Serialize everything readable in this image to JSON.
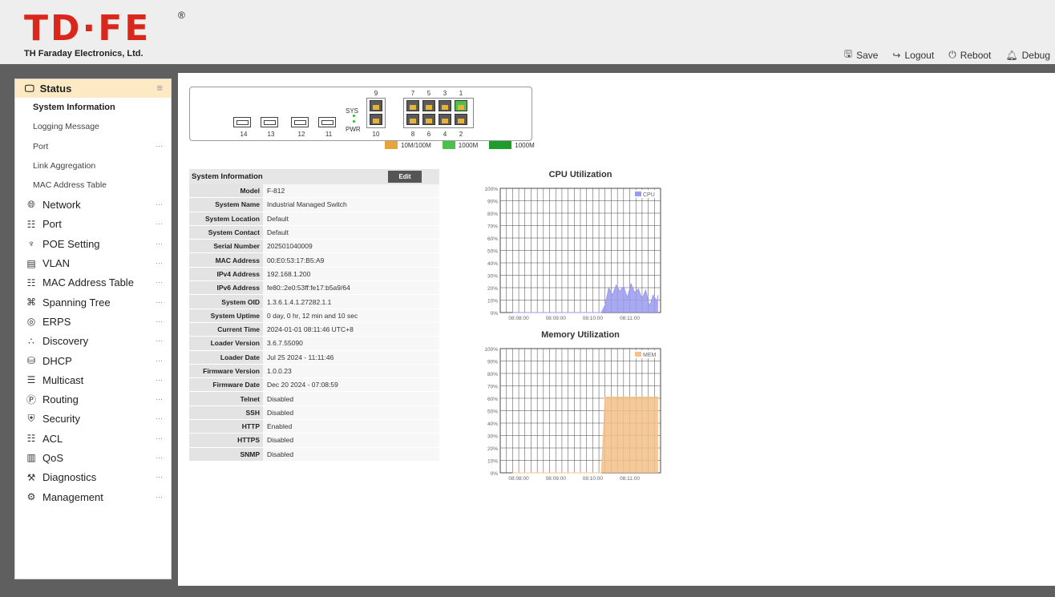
{
  "header": {
    "logo_text": "TD·FE",
    "logo_reg": "®",
    "company": "TH Faraday Electronics, Ltd.",
    "actions": [
      {
        "label": "Save",
        "icon": "save-icon"
      },
      {
        "label": "Logout",
        "icon": "logout-icon"
      },
      {
        "label": "Reboot",
        "icon": "power-icon"
      },
      {
        "label": "Debug",
        "icon": "bell-icon"
      }
    ]
  },
  "sidebar": {
    "status": {
      "label": "Status",
      "items": [
        "System Information",
        "Logging Message",
        "Port",
        "Link Aggregation",
        "MAC Address Table"
      ]
    },
    "menu": [
      {
        "label": "Network",
        "icon": "globe-icon"
      },
      {
        "label": "Port",
        "icon": "port-icon"
      },
      {
        "label": "POE Setting",
        "icon": "plug-icon"
      },
      {
        "label": "VLAN",
        "icon": "vlan-icon"
      },
      {
        "label": "MAC Address Table",
        "icon": "table-icon"
      },
      {
        "label": "Spanning Tree",
        "icon": "tree-icon"
      },
      {
        "label": "ERPS",
        "icon": "ring-icon"
      },
      {
        "label": "Discovery",
        "icon": "discovery-icon"
      },
      {
        "label": "DHCP",
        "icon": "database-icon"
      },
      {
        "label": "Multicast",
        "icon": "multicast-icon"
      },
      {
        "label": "Routing",
        "icon": "routing-icon"
      },
      {
        "label": "Security",
        "icon": "shield-icon"
      },
      {
        "label": "ACL",
        "icon": "acl-icon"
      },
      {
        "label": "QoS",
        "icon": "qos-icon"
      },
      {
        "label": "Diagnostics",
        "icon": "wrench-icon"
      },
      {
        "label": "Management",
        "icon": "gear-icon"
      }
    ]
  },
  "panel": {
    "sfp_ports": [
      "14",
      "13",
      "12",
      "11"
    ],
    "sys_label": "SYS",
    "pwr_label": "PWR",
    "top_ports": [
      "9",
      "7",
      "5",
      "3",
      "1"
    ],
    "bottom_ports": [
      "10",
      "8",
      "6",
      "4",
      "2"
    ],
    "legend": [
      "10M/100M",
      "1000M",
      "1000M"
    ],
    "colors": {
      "amber": "#e8a33a",
      "green": "#4cc04c",
      "dark_green": "#1e9d2c"
    }
  },
  "system_info": {
    "title": "System Information",
    "edit_label": "Edit",
    "rows": [
      {
        "key": "Model",
        "value": "F-812"
      },
      {
        "key": "System Name",
        "value": "Industrial Managed Switch"
      },
      {
        "key": "System Location",
        "value": "Default"
      },
      {
        "key": "System Contact",
        "value": "Default"
      },
      {
        "key": "Serial Number",
        "value": "202501040009"
      },
      {
        "key": "MAC Address",
        "value": "00:E0:53:17:B5:A9"
      },
      {
        "key": "IPv4 Address",
        "value": "192.168.1.200"
      },
      {
        "key": "IPv6 Address",
        "value": "fe80::2e0:53ff:fe17:b5a9/64"
      },
      {
        "key": "System OID",
        "value": "1.3.6.1.4.1.27282.1.1"
      },
      {
        "key": "System Uptime",
        "value": "0 day, 0 hr, 12 min and 10 sec"
      },
      {
        "key": "Current Time",
        "value": "2024-01-01 08:11:46 UTC+8"
      },
      {
        "key": "Loader Version",
        "value": "3.6.7.55090"
      },
      {
        "key": "Loader Date",
        "value": "Jul 25 2024 - 11:11:46"
      },
      {
        "key": "Firmware Version",
        "value": "1.0.0.23"
      },
      {
        "key": "Firmware Date",
        "value": "Dec 20 2024 - 07:08:59"
      },
      {
        "key": "Telnet",
        "value": "Disabled"
      },
      {
        "key": "SSH",
        "value": "Disabled"
      },
      {
        "key": "HTTP",
        "value": "Enabled"
      },
      {
        "key": "HTTPS",
        "value": "Disabled"
      },
      {
        "key": "SNMP",
        "value": "Disabled"
      }
    ]
  },
  "chart_data": [
    {
      "type": "area",
      "title": "CPU Utilization",
      "legend": "CPU",
      "color": "#9a9af0",
      "ylim": [
        0,
        100
      ],
      "yticks": [
        "0%",
        "10%",
        "20%",
        "30%",
        "40%",
        "50%",
        "60%",
        "70%",
        "80%",
        "90%",
        "100%"
      ],
      "xticks": [
        "08:08:00",
        "08:09:00",
        "08:10:00",
        "08:11:00"
      ],
      "x": [
        "08:07:50",
        "08:10:14",
        "08:10:20",
        "08:10:26",
        "08:10:32",
        "08:10:38",
        "08:10:44",
        "08:10:50",
        "08:10:56",
        "08:11:02",
        "08:11:08",
        "08:11:14",
        "08:11:20",
        "08:11:26",
        "08:11:32",
        "08:11:38",
        "08:11:44",
        "08:11:46"
      ],
      "values": [
        0,
        0,
        6,
        20,
        14,
        22,
        17,
        21,
        12,
        23,
        16,
        19,
        11,
        18,
        5,
        14,
        9,
        14
      ],
      "grid": true,
      "legend_position": "top-right"
    },
    {
      "type": "area",
      "title": "Memory Utilization",
      "legend": "MEM",
      "color": "#f5c08a",
      "ylim": [
        0,
        100
      ],
      "yticks": [
        "0%",
        "10%",
        "20%",
        "30%",
        "40%",
        "50%",
        "60%",
        "70%",
        "80%",
        "90%",
        "100%"
      ],
      "xticks": [
        "08:08:00",
        "08:09:00",
        "08:10:00",
        "08:11:00"
      ],
      "x": [
        "08:07:50",
        "08:10:14",
        "08:10:20",
        "08:11:46"
      ],
      "values": [
        0,
        0,
        61,
        61
      ],
      "grid": true,
      "legend_position": "top-right"
    }
  ]
}
